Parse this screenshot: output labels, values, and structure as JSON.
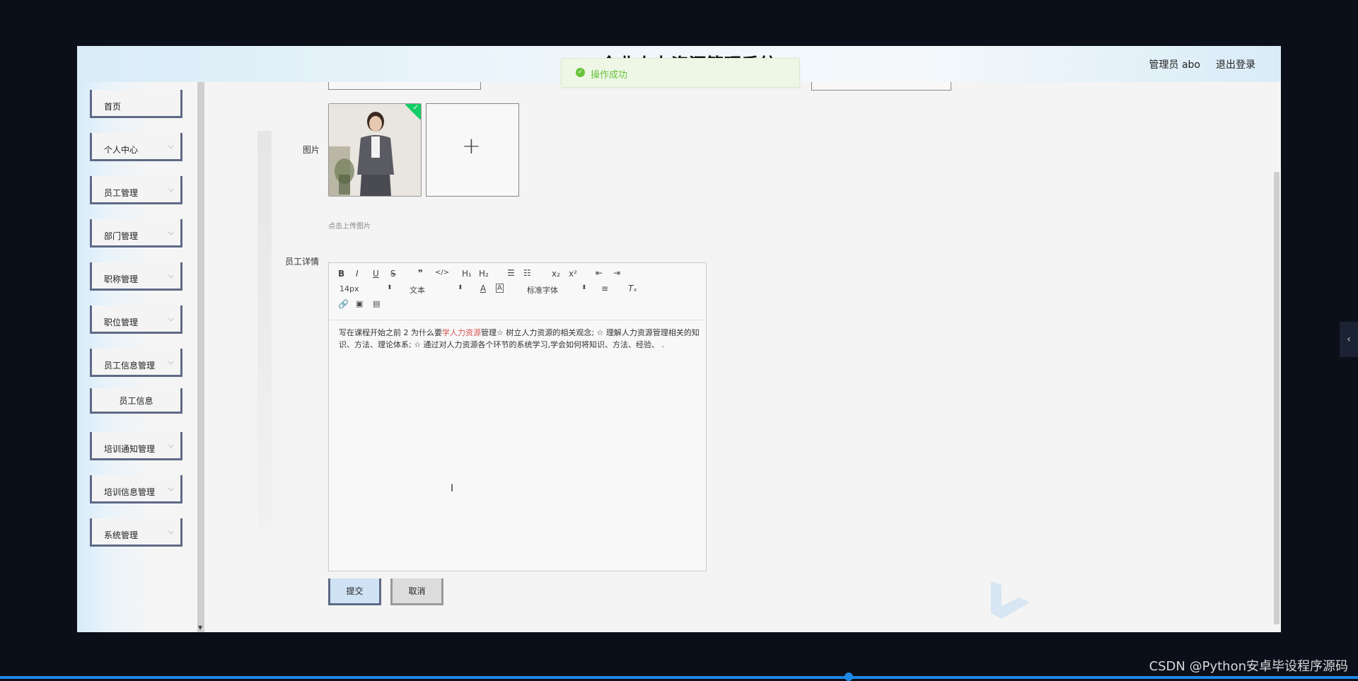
{
  "header": {
    "title": "企业人力资源管理系统",
    "admin_label": "管理员 abo",
    "logout_label": "退出登录"
  },
  "toast": {
    "message": "操作成功"
  },
  "sidebar": {
    "items": [
      {
        "label": "首页",
        "chevron": ""
      },
      {
        "label": "个人中心",
        "chevron": "⌵"
      },
      {
        "label": "员工管理",
        "chevron": "⌵"
      },
      {
        "label": "部门管理",
        "chevron": "⌵"
      },
      {
        "label": "职称管理",
        "chevron": "⌵"
      },
      {
        "label": "职位管理",
        "chevron": "⌵"
      },
      {
        "label": "员工信息管理",
        "chevron": "⌵"
      },
      {
        "label": "培训通知管理",
        "chevron": "⌵"
      },
      {
        "label": "培训信息管理",
        "chevron": "⌵"
      },
      {
        "label": "系统管理",
        "chevron": "⌵"
      }
    ],
    "sub_item": "员工信息"
  },
  "form": {
    "image_label": "图片",
    "upload_hint": "点击上传图片",
    "detail_label": "员工详情",
    "font_size": "14px",
    "text_type": "文本",
    "font_family": "标准字体",
    "detail_text_before": "写在课程开始之前 2 为什么要",
    "detail_text_red": "学人力资源",
    "detail_text_after": "管理☆ 树立人力资源的相关观念; ☆ 理解人力资源管理相关的知识、方法、理论体系; ☆ 通过对人力资源各个环节的系统学习,学会如何将知识、方法、经验、 .",
    "submit_label": "提交",
    "cancel_label": "取消"
  },
  "footer": {
    "watermark": "CSDN @Python安卓毕设程序源码"
  },
  "icons": [
    "check-circle-icon",
    "chevron-down-icon",
    "plus-icon",
    "bold-icon",
    "italic-icon",
    "underline-icon",
    "strike-icon",
    "quote-icon",
    "code-icon",
    "h1-icon",
    "h2-icon",
    "ordered-list-icon",
    "bullet-list-icon",
    "subscript-icon",
    "superscript-icon",
    "outdent-icon",
    "indent-icon",
    "font-color-icon",
    "bg-color-icon",
    "align-icon",
    "clear-format-icon",
    "link-icon",
    "image-icon",
    "video-icon",
    "text-cursor-icon",
    "chevron-left-icon"
  ],
  "colors": {
    "accent": "#5f6a86",
    "success": "#67c23a",
    "highlight": "#d9534f"
  }
}
